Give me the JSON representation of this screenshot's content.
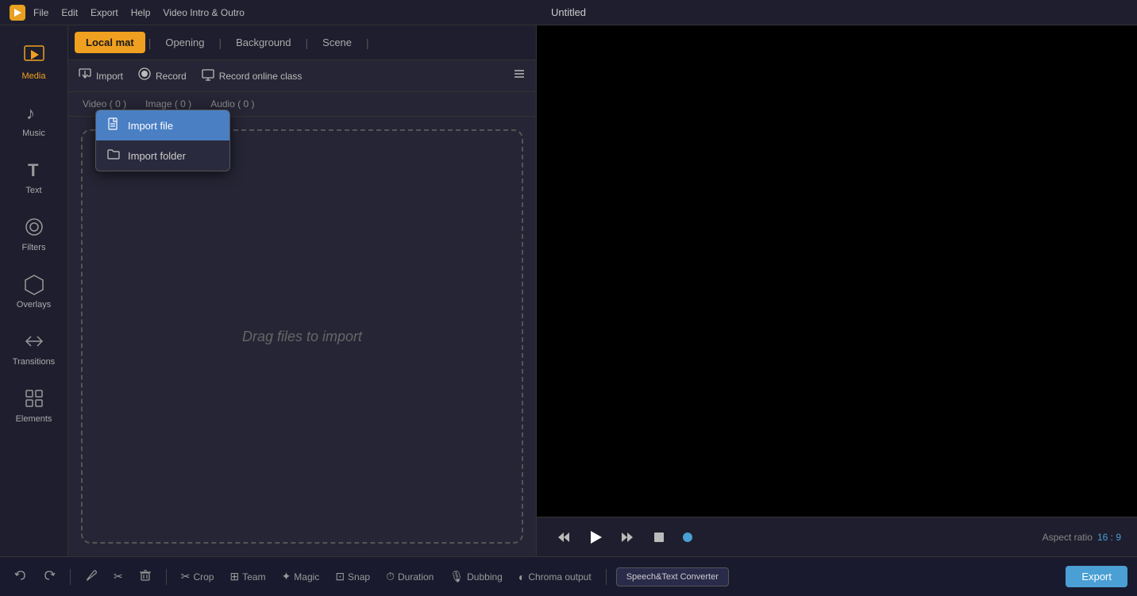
{
  "titlebar": {
    "logo": "P",
    "menu": [
      "File",
      "Edit",
      "Export",
      "Help",
      "Video Intro & Outro"
    ],
    "title": "Untitled"
  },
  "sidebar": {
    "items": [
      {
        "id": "media",
        "label": "Media",
        "icon": "▶",
        "active": true
      },
      {
        "id": "music",
        "label": "Music",
        "icon": "♪"
      },
      {
        "id": "text",
        "label": "Text",
        "icon": "T"
      },
      {
        "id": "filters",
        "label": "Filters",
        "icon": "◎"
      },
      {
        "id": "overlays",
        "label": "Overlays",
        "icon": "⬡"
      },
      {
        "id": "transitions",
        "label": "Transitions",
        "icon": "⇄"
      },
      {
        "id": "elements",
        "label": "Elements",
        "icon": "⊞"
      }
    ]
  },
  "media_panel": {
    "tabs": [
      {
        "id": "local_mat",
        "label": "Local mat",
        "active": true
      },
      {
        "id": "opening",
        "label": "Opening"
      },
      {
        "id": "background",
        "label": "Background"
      },
      {
        "id": "scene",
        "label": "Scene"
      }
    ],
    "toolbar": {
      "import_label": "Import",
      "record_label": "Record",
      "record_online_label": "Record online class"
    },
    "sub_tabs": [
      {
        "id": "video",
        "label": "Video ( 0 )"
      },
      {
        "id": "image",
        "label": "Image ( 0 )"
      },
      {
        "id": "audio",
        "label": "Audio ( 0 )"
      }
    ],
    "drop_text": "Drag files to import"
  },
  "dropdown": {
    "items": [
      {
        "id": "import_file",
        "label": "Import file",
        "icon": "📄",
        "highlighted": true
      },
      {
        "id": "import_folder",
        "label": "Import folder",
        "icon": "📁",
        "highlighted": false
      }
    ]
  },
  "preview": {
    "aspect_ratio_label": "Aspect ratio",
    "aspect_ratio_value": "16 : 9"
  },
  "bottom_bar": {
    "undo_label": "",
    "redo_label": "",
    "tools": [
      {
        "id": "crop",
        "label": "Crop",
        "icon": "✂"
      },
      {
        "id": "team",
        "label": "Team",
        "icon": "⊞"
      },
      {
        "id": "magic",
        "label": "Magic",
        "icon": "✦"
      },
      {
        "id": "snap",
        "label": "Snap",
        "icon": "⊡"
      },
      {
        "id": "duration",
        "label": "Duration",
        "icon": "⏱"
      },
      {
        "id": "dubbing",
        "label": "Dubbing",
        "icon": "🎙"
      },
      {
        "id": "chroma",
        "label": "Chroma output",
        "icon": "◐"
      }
    ],
    "speech_btn": "Speech&Text Converter",
    "export_btn": "Export"
  }
}
